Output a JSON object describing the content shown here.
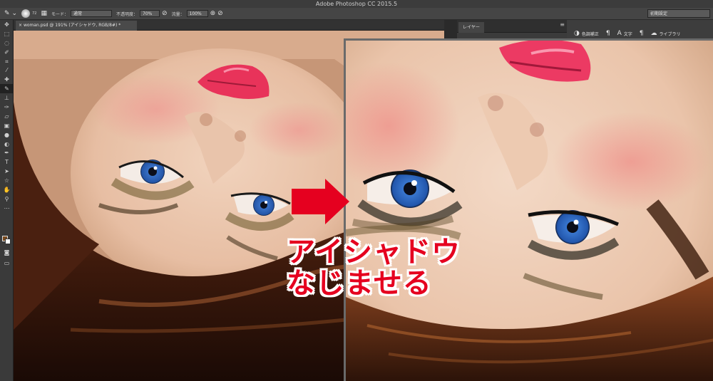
{
  "window": {
    "title": "Adobe Photoshop CC 2015.5"
  },
  "options": {
    "mode_label": "モード：",
    "mode_value": "通常",
    "opacity_label": "不透明度：",
    "opacity_value": "70%",
    "flow_label": "流量：",
    "flow_value": "100%",
    "brush_size": "72",
    "presets": "初期設定"
  },
  "document": {
    "tab_label": "woman.psd @ 191% (アイシャドウ, RGB/8#) *"
  },
  "panels": {
    "layers_tab": "レイヤー",
    "adjustments": "色調補正",
    "character": "文字",
    "libraries": "ライブラリ"
  },
  "annotation": {
    "line1": "アイシャドウ",
    "line2": "なじませる"
  },
  "colors": {
    "accent": "#e5001f",
    "foreground_swatch": "#7a4a1e"
  },
  "icons": [
    "move-icon",
    "marquee-icon",
    "lasso-icon",
    "quick-select-icon",
    "crop-icon",
    "eyedropper-icon",
    "healing-icon",
    "brush-icon",
    "stamp-icon",
    "history-brush-icon",
    "eraser-icon",
    "gradient-icon",
    "blur-icon",
    "dodge-icon",
    "pen-icon",
    "type-icon",
    "path-select-icon",
    "shape-icon",
    "hand-icon",
    "zoom-icon"
  ]
}
